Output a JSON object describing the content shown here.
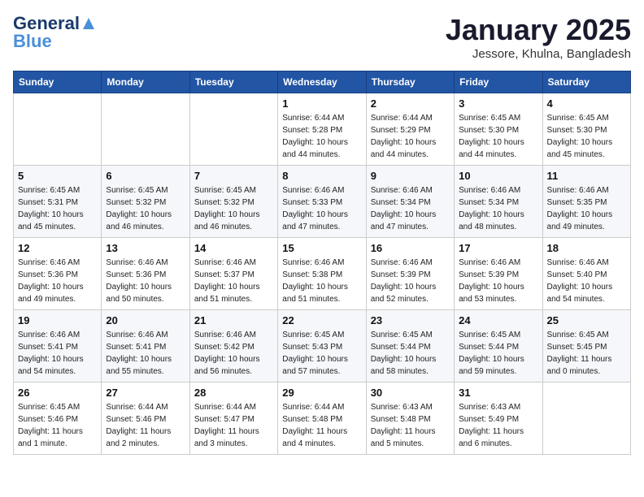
{
  "header": {
    "logo_general": "General",
    "logo_blue": "Blue",
    "month_title": "January 2025",
    "subtitle": "Jessore, Khulna, Bangladesh"
  },
  "calendar": {
    "days_of_week": [
      "Sunday",
      "Monday",
      "Tuesday",
      "Wednesday",
      "Thursday",
      "Friday",
      "Saturday"
    ],
    "weeks": [
      [
        {
          "day": "",
          "info": ""
        },
        {
          "day": "",
          "info": ""
        },
        {
          "day": "",
          "info": ""
        },
        {
          "day": "1",
          "info": "Sunrise: 6:44 AM\nSunset: 5:28 PM\nDaylight: 10 hours\nand 44 minutes."
        },
        {
          "day": "2",
          "info": "Sunrise: 6:44 AM\nSunset: 5:29 PM\nDaylight: 10 hours\nand 44 minutes."
        },
        {
          "day": "3",
          "info": "Sunrise: 6:45 AM\nSunset: 5:30 PM\nDaylight: 10 hours\nand 44 minutes."
        },
        {
          "day": "4",
          "info": "Sunrise: 6:45 AM\nSunset: 5:30 PM\nDaylight: 10 hours\nand 45 minutes."
        }
      ],
      [
        {
          "day": "5",
          "info": "Sunrise: 6:45 AM\nSunset: 5:31 PM\nDaylight: 10 hours\nand 45 minutes."
        },
        {
          "day": "6",
          "info": "Sunrise: 6:45 AM\nSunset: 5:32 PM\nDaylight: 10 hours\nand 46 minutes."
        },
        {
          "day": "7",
          "info": "Sunrise: 6:45 AM\nSunset: 5:32 PM\nDaylight: 10 hours\nand 46 minutes."
        },
        {
          "day": "8",
          "info": "Sunrise: 6:46 AM\nSunset: 5:33 PM\nDaylight: 10 hours\nand 47 minutes."
        },
        {
          "day": "9",
          "info": "Sunrise: 6:46 AM\nSunset: 5:34 PM\nDaylight: 10 hours\nand 47 minutes."
        },
        {
          "day": "10",
          "info": "Sunrise: 6:46 AM\nSunset: 5:34 PM\nDaylight: 10 hours\nand 48 minutes."
        },
        {
          "day": "11",
          "info": "Sunrise: 6:46 AM\nSunset: 5:35 PM\nDaylight: 10 hours\nand 49 minutes."
        }
      ],
      [
        {
          "day": "12",
          "info": "Sunrise: 6:46 AM\nSunset: 5:36 PM\nDaylight: 10 hours\nand 49 minutes."
        },
        {
          "day": "13",
          "info": "Sunrise: 6:46 AM\nSunset: 5:36 PM\nDaylight: 10 hours\nand 50 minutes."
        },
        {
          "day": "14",
          "info": "Sunrise: 6:46 AM\nSunset: 5:37 PM\nDaylight: 10 hours\nand 51 minutes."
        },
        {
          "day": "15",
          "info": "Sunrise: 6:46 AM\nSunset: 5:38 PM\nDaylight: 10 hours\nand 51 minutes."
        },
        {
          "day": "16",
          "info": "Sunrise: 6:46 AM\nSunset: 5:39 PM\nDaylight: 10 hours\nand 52 minutes."
        },
        {
          "day": "17",
          "info": "Sunrise: 6:46 AM\nSunset: 5:39 PM\nDaylight: 10 hours\nand 53 minutes."
        },
        {
          "day": "18",
          "info": "Sunrise: 6:46 AM\nSunset: 5:40 PM\nDaylight: 10 hours\nand 54 minutes."
        }
      ],
      [
        {
          "day": "19",
          "info": "Sunrise: 6:46 AM\nSunset: 5:41 PM\nDaylight: 10 hours\nand 54 minutes."
        },
        {
          "day": "20",
          "info": "Sunrise: 6:46 AM\nSunset: 5:41 PM\nDaylight: 10 hours\nand 55 minutes."
        },
        {
          "day": "21",
          "info": "Sunrise: 6:46 AM\nSunset: 5:42 PM\nDaylight: 10 hours\nand 56 minutes."
        },
        {
          "day": "22",
          "info": "Sunrise: 6:45 AM\nSunset: 5:43 PM\nDaylight: 10 hours\nand 57 minutes."
        },
        {
          "day": "23",
          "info": "Sunrise: 6:45 AM\nSunset: 5:44 PM\nDaylight: 10 hours\nand 58 minutes."
        },
        {
          "day": "24",
          "info": "Sunrise: 6:45 AM\nSunset: 5:44 PM\nDaylight: 10 hours\nand 59 minutes."
        },
        {
          "day": "25",
          "info": "Sunrise: 6:45 AM\nSunset: 5:45 PM\nDaylight: 11 hours\nand 0 minutes."
        }
      ],
      [
        {
          "day": "26",
          "info": "Sunrise: 6:45 AM\nSunset: 5:46 PM\nDaylight: 11 hours\nand 1 minute."
        },
        {
          "day": "27",
          "info": "Sunrise: 6:44 AM\nSunset: 5:46 PM\nDaylight: 11 hours\nand 2 minutes."
        },
        {
          "day": "28",
          "info": "Sunrise: 6:44 AM\nSunset: 5:47 PM\nDaylight: 11 hours\nand 3 minutes."
        },
        {
          "day": "29",
          "info": "Sunrise: 6:44 AM\nSunset: 5:48 PM\nDaylight: 11 hours\nand 4 minutes."
        },
        {
          "day": "30",
          "info": "Sunrise: 6:43 AM\nSunset: 5:48 PM\nDaylight: 11 hours\nand 5 minutes."
        },
        {
          "day": "31",
          "info": "Sunrise: 6:43 AM\nSunset: 5:49 PM\nDaylight: 11 hours\nand 6 minutes."
        },
        {
          "day": "",
          "info": ""
        }
      ]
    ]
  }
}
